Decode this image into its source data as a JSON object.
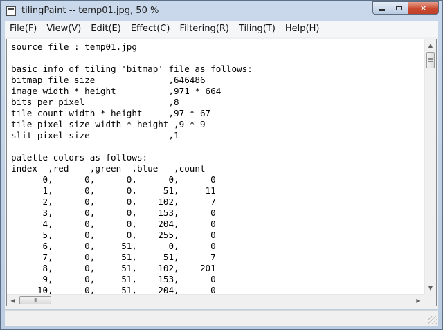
{
  "window": {
    "title": "tilingPaint -- temp01.jpg, 50 %"
  },
  "menu": [
    {
      "label": "File(F)",
      "name": "menu-file"
    },
    {
      "label": "View(V)",
      "name": "menu-view"
    },
    {
      "label": "Edit(E)",
      "name": "menu-edit"
    },
    {
      "label": "Effect(C)",
      "name": "menu-effect"
    },
    {
      "label": "Filtering(R)",
      "name": "menu-filtering"
    },
    {
      "label": "Tiling(T)",
      "name": "menu-tiling"
    },
    {
      "label": "Help(H)",
      "name": "menu-help"
    }
  ],
  "document": {
    "lines": [
      "source file : temp01.jpg",
      "",
      "basic info of tiling 'bitmap' file as follows:",
      "bitmap file size              ,646486",
      "image width * height          ,971 * 664",
      "bits per pixel                ,8",
      "tile count width * height     ,97 * 67",
      "tile pixel size width * height ,9 * 9",
      "slit pixel size               ,1",
      "",
      "palette colors as follows:",
      "index  ,red    ,green  ,blue   ,count",
      "      0,      0,      0,      0,      0",
      "      1,      0,      0,     51,     11",
      "      2,      0,      0,    102,      7",
      "      3,      0,      0,    153,      0",
      "      4,      0,      0,    204,      0",
      "      5,      0,      0,    255,      0",
      "      6,      0,     51,      0,      0",
      "      7,      0,     51,     51,      7",
      "      8,      0,     51,    102,    201",
      "      9,      0,     51,    153,      0",
      "     10,      0,     51,    204,      0"
    ]
  },
  "scrollbars": {
    "h_thumb_glyph": "III"
  }
}
